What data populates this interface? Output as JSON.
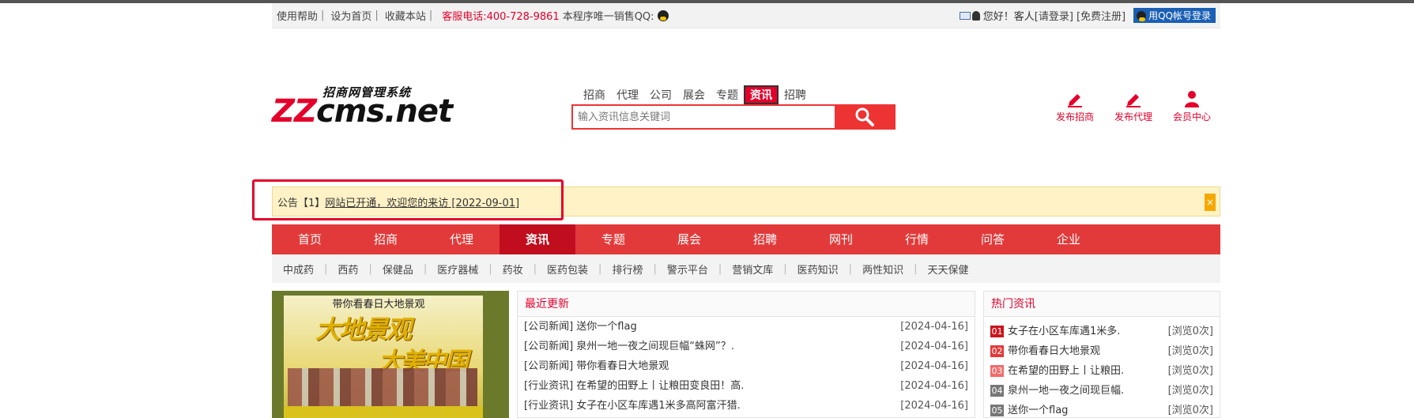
{
  "util_bar": {
    "help": "使用帮助",
    "set_home": "设为首页",
    "favorite": "收藏本站",
    "hotline": "客服电话:400-728-9861",
    "qq_sales": "本程序唯一销售QQ:",
    "greeting": "您好！客人",
    "login": "[请登录]",
    "register": "[免费注册]",
    "qq_login": "用QQ帐号登录"
  },
  "logo": {
    "tagline": "招商网管理系统",
    "brand_prefix": "ZZ",
    "brand_rest": "cms.net"
  },
  "search": {
    "tabs": [
      "招商",
      "代理",
      "公司",
      "展会",
      "专题",
      "资讯",
      "招聘"
    ],
    "active_tab": "资讯",
    "placeholder": "输入资讯信息关键词"
  },
  "quick_links": [
    {
      "label": "发布招商",
      "icon": "pencil-icon"
    },
    {
      "label": "发布代理",
      "icon": "pencil-icon"
    },
    {
      "label": "会员中心",
      "icon": "user-icon"
    }
  ],
  "notice": {
    "prefix": "公告【1】",
    "text": "网站已开通，欢迎您的来访 [2022-09-01]",
    "close": "×"
  },
  "main_nav": [
    "首页",
    "招商",
    "代理",
    "资讯",
    "专题",
    "展会",
    "招聘",
    "网刊",
    "行情",
    "问答",
    "企业"
  ],
  "main_nav_active": "资讯",
  "sub_nav": [
    "中成药",
    "西药",
    "保健品",
    "医疗器械",
    "药妆",
    "医药包装",
    "排行榜",
    "警示平台",
    "营销文库",
    "医药知识",
    "两性知识",
    "天天保健"
  ],
  "banner": {
    "caption": "带你看春日大地景观",
    "poster_line1": "大地景观",
    "poster_line2": "大美中国"
  },
  "latest": {
    "title": "最近更新",
    "items": [
      {
        "cat": "[公司新闻]",
        "title": "送你一个flag",
        "date": "[2024-04-16]"
      },
      {
        "cat": "[公司新闻]",
        "title": "泉州一地一夜之间现巨幅“蛛网”？.",
        "date": "[2024-04-16]"
      },
      {
        "cat": "[公司新闻]",
        "title": "带你看春日大地景观",
        "date": "[2024-04-16]"
      },
      {
        "cat": "[行业资讯]",
        "title": "在希望的田野上丨让粮田变良田！高.",
        "date": "[2024-04-16]"
      },
      {
        "cat": "[行业资讯]",
        "title": "女子在小区车库遇1米多高阿富汗猎.",
        "date": "[2024-04-16]"
      }
    ]
  },
  "hot": {
    "title": "热门资讯",
    "items": [
      {
        "rank": "01",
        "title": "女子在小区车库遇1米多.",
        "views": "[浏览0次]",
        "color": "#c8161d"
      },
      {
        "rank": "02",
        "title": "带你看春日大地景观",
        "views": "[浏览0次]",
        "color": "#e23a3a"
      },
      {
        "rank": "03",
        "title": "在希望的田野上丨让粮田.",
        "views": "[浏览0次]",
        "color": "#f26b6b"
      },
      {
        "rank": "04",
        "title": "泉州一地一夜之间现巨幅.",
        "views": "[浏览0次]",
        "color": "#777777"
      },
      {
        "rank": "05",
        "title": "送你一个flag",
        "views": "[浏览0次]",
        "color": "#777777"
      }
    ]
  }
}
